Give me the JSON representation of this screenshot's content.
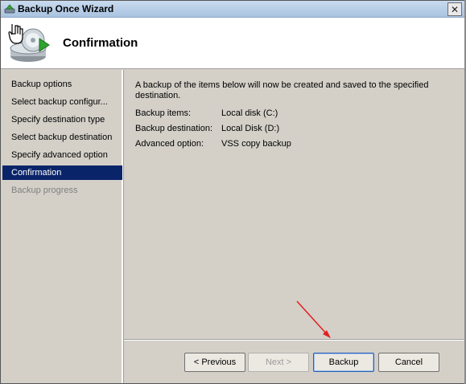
{
  "window": {
    "title": "Backup Once Wizard",
    "close_glyph": "✕",
    "title_icon": "backup-icon"
  },
  "header": {
    "title": "Confirmation",
    "icon": "backup-disc-hand-icon"
  },
  "sidebar": {
    "items": [
      {
        "label": "Backup options",
        "state": "normal"
      },
      {
        "label": "Select backup configur...",
        "state": "normal"
      },
      {
        "label": "Specify destination type",
        "state": "normal"
      },
      {
        "label": "Select backup destination",
        "state": "normal"
      },
      {
        "label": "Specify advanced option",
        "state": "normal"
      },
      {
        "label": "Confirmation",
        "state": "active"
      },
      {
        "label": "Backup progress",
        "state": "disabled"
      }
    ]
  },
  "main": {
    "intro": "A backup of the items below will now be created and saved to the specified destination.",
    "details": [
      {
        "label": "Backup items:",
        "value": "Local disk (C:)"
      },
      {
        "label": "Backup destination:",
        "value": "Local Disk (D:)"
      },
      {
        "label": "Advanced option:",
        "value": "VSS copy backup"
      }
    ]
  },
  "buttons": {
    "previous": "< Previous",
    "next": "Next >",
    "backup": "Backup",
    "cancel": "Cancel"
  },
  "annotation": {
    "color": "#e02020"
  }
}
